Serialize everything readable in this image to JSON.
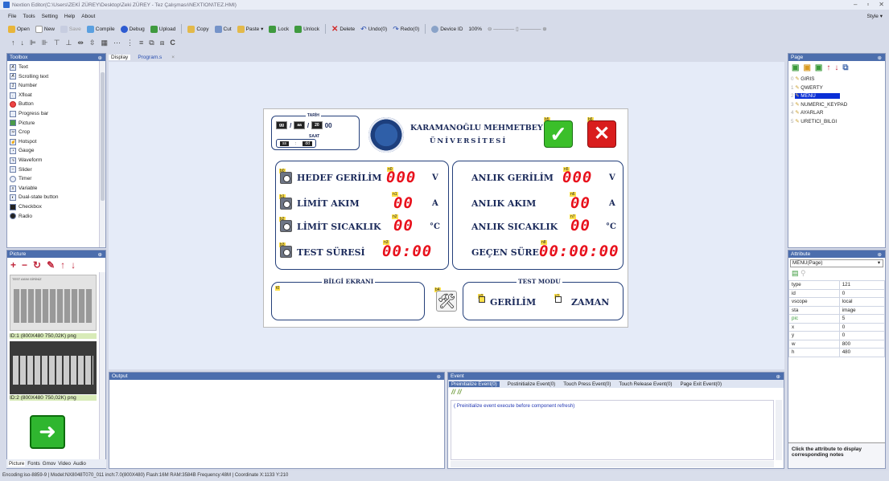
{
  "window": {
    "title": "Nextion Editor(C:\\Users\\ZEKİ ZÜREY\\Desktop\\Zeki ZÜREY - Tez Çalışması\\NEXTION\\TEZ.HMI)",
    "min": "–",
    "max": "▫",
    "close": "✕"
  },
  "menu": [
    "File",
    "Tools",
    "Setting",
    "Help",
    "About"
  ],
  "style_label": "Style ▾",
  "toolbar": [
    "Open",
    "New",
    "Save",
    "Compile",
    "Debug",
    "Upload",
    "Copy",
    "Cut",
    "Paste ▾",
    "Lock",
    "Unlock",
    "Delete",
    "Undo(0)",
    "Redo(0)",
    "Device ID",
    "100%"
  ],
  "toolbox": {
    "title": "Toolbox",
    "items": [
      "Text",
      "Scrolling text",
      "Number",
      "Xfloat",
      "Button",
      "Progress bar",
      "Picture",
      "Crop",
      "Hotspot",
      "Gauge",
      "Waveform",
      "Slider",
      "Timer",
      "Variable",
      "Dual-state button",
      "Checkbox",
      "Radio"
    ]
  },
  "picture_panel": {
    "title": "Picture",
    "thumb_text": "TEST AKIM GİRİNİZ",
    "items": [
      "ID:1  (800X480 750,02K) png",
      "ID:2  (800X480 750,02K) png"
    ],
    "tabs": [
      "Picture",
      "Fonts",
      "Gmov",
      "Video",
      "Audio"
    ]
  },
  "doc_tabs": [
    "Display",
    "Program.s",
    "×"
  ],
  "hmi": {
    "tarih_label": "TARİH",
    "tarih_parts": [
      "gg",
      "aa",
      "20"
    ],
    "year_suffix": "00",
    "saat_label": "SAAT",
    "saat_parts": [
      "ss",
      "dd"
    ],
    "university_line1": "KARAMANOĞLU MEHMETBEY",
    "university_line2": "ÜNİVERSİTESİ",
    "left_rows": [
      {
        "label": "HEDEF GERİLİM",
        "value": "000",
        "unit": "V",
        "tag": "n0",
        "icon_tag": "b0"
      },
      {
        "label": "LİMİT AKIM",
        "value": "00",
        "unit": "A",
        "tag": "n1",
        "icon_tag": "b1"
      },
      {
        "label": "LİMİT SICAKLIK",
        "value": "00",
        "unit": "°C",
        "tag": "n2",
        "icon_tag": "b2"
      },
      {
        "label": "TEST SÜRESİ",
        "value": "00:00",
        "unit": "",
        "tag": "n3",
        "icon_tag": "b3"
      }
    ],
    "right_rows": [
      {
        "label": "ANLIK GERİLİM",
        "value": "000",
        "unit": "V",
        "tag": "n5"
      },
      {
        "label": "ANLIK AKIM",
        "value": "00",
        "unit": "A",
        "tag": "n6"
      },
      {
        "label": "ANLIK SICAKLIK",
        "value": "00",
        "unit": "°C",
        "tag": "n7"
      },
      {
        "label": "GEÇEN SÜRE",
        "value": "00:00:00",
        "unit": "",
        "tag": "n8"
      }
    ],
    "info_title": "BİLGİ EKRANI",
    "info_tag": "t0",
    "mode_title": "TEST MODU",
    "mode_gerilim": "GERİLİM",
    "mode_zaman": "ZAMAN",
    "mode_gerilim_tag": "c0",
    "mode_zaman_tag": "c1",
    "ok_tag": "b5",
    "cancel_tag": "b6",
    "tool_tag": "b4"
  },
  "output": {
    "title": "Output"
  },
  "event": {
    "title": "Event",
    "tabs": [
      "Preinitialize Event(0)",
      "Postinitialize Event(0)",
      "Touch Press Event(0)",
      "Touch Release Event(0)",
      "Page Exit Event(0)"
    ],
    "comment": "( Preinitialize event execute before component refresh)"
  },
  "page_panel": {
    "title": "Page",
    "pages": [
      "GIRIS",
      "QWERTY",
      "MENU",
      "NUMERIC_KEYPAD",
      "AYARLAR",
      "URETICI_BILGI"
    ],
    "selected": "MENU"
  },
  "attribute_panel": {
    "title": "Attribute",
    "selector": "MENU(Page)",
    "rows": [
      [
        "type",
        "121"
      ],
      [
        "id",
        "0"
      ],
      [
        "vscope",
        "local"
      ],
      [
        "sta",
        "image"
      ],
      [
        "pic",
        "5"
      ],
      [
        "x",
        "0"
      ],
      [
        "y",
        "0"
      ],
      [
        "w",
        "800"
      ],
      [
        "h",
        "480"
      ]
    ],
    "note": "Click the attribute to display corresponding notes"
  },
  "status_bar": "Encoding:iso-8859-9 | Model:NX8048T070_011  inch:7.0(800X480) Flash:16M RAM:3584B Frequency:48M |  Coordinate X:1133  Y:210",
  "colors": {
    "accent": "#4c6ead",
    "led": "#e8111c",
    "navy": "#243f7a",
    "selected": "#0a2fd6"
  }
}
